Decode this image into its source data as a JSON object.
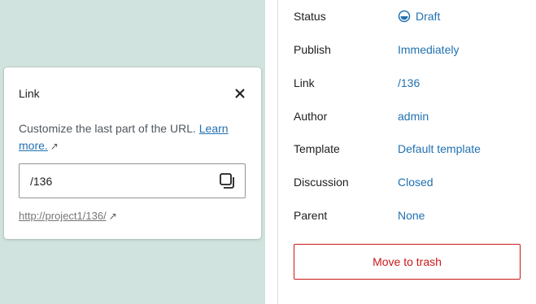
{
  "colors": {
    "canvas": "#d1e3de",
    "accent": "#2271b1",
    "danger": "#cc1818"
  },
  "link_popover": {
    "title": "Link",
    "close_icon": "close-icon",
    "description": "Customize the last part of the URL.",
    "learn_more": "Learn more.",
    "external_icon": "↗",
    "slug_value": "/136",
    "copy_icon": "copy-icon",
    "permalink": "http://project1/136/"
  },
  "sidebar": {
    "rows": [
      {
        "label": "Status",
        "value": "Draft",
        "icon": "draft-status-icon"
      },
      {
        "label": "Publish",
        "value": "Immediately"
      },
      {
        "label": "Link",
        "value": "/136"
      },
      {
        "label": "Author",
        "value": "admin"
      },
      {
        "label": "Template",
        "value": "Default template"
      },
      {
        "label": "Discussion",
        "value": "Closed"
      },
      {
        "label": "Parent",
        "value": "None"
      }
    ],
    "trash_label": "Move to trash"
  }
}
